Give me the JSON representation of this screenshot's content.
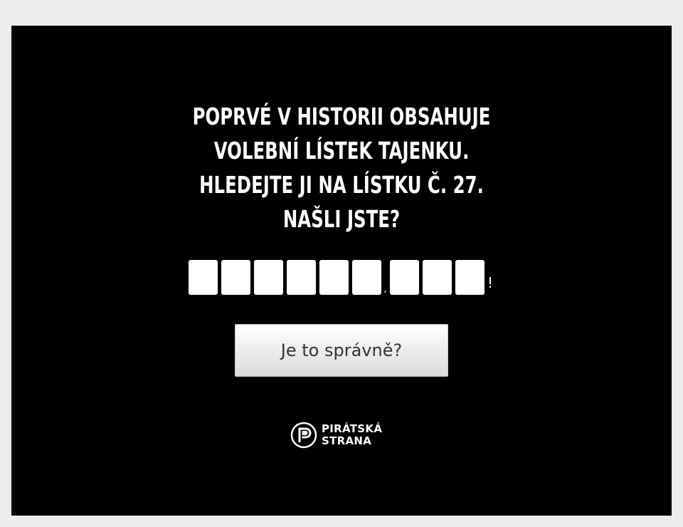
{
  "headline": {
    "line1": "POPRVÉ V HISTORII OBSAHUJE",
    "line2": "VOLEBNÍ LÍSTEK TAJENKU.",
    "line3": "HLEDEJTE JI NA LÍSTKU Č. 27.",
    "line4": "NAŠLI JSTE?"
  },
  "answer": {
    "word1_letters": [
      "",
      "",
      "",
      "",
      "",
      ""
    ],
    "separator": ",",
    "word2_letters": [
      "",
      "",
      ""
    ],
    "ending": "!"
  },
  "submit_label": "Je to správně?",
  "logo": {
    "icon": "pirate-flag-icon",
    "line1": "PIRÁTSKÁ",
    "line2": "STRANA"
  },
  "colors": {
    "page_background": "#ededed",
    "panel_background": "#000000",
    "text": "#ffffff",
    "button_text": "#333333"
  }
}
